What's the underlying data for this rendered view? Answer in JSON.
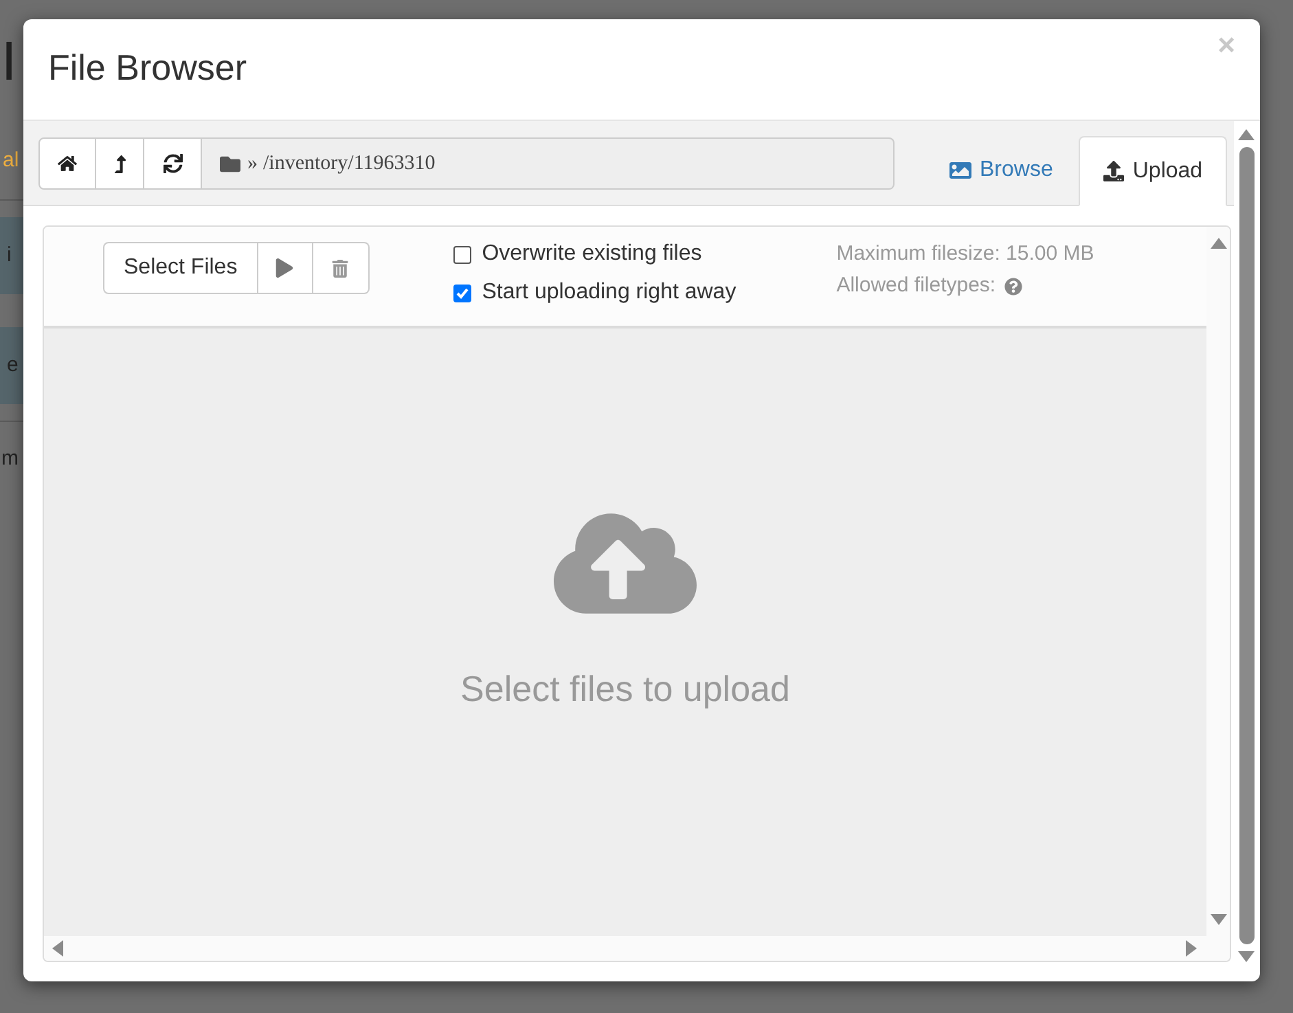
{
  "background": {
    "fragments": [
      {
        "text": "I",
        "kind": "heading"
      },
      {
        "text": "al",
        "kind": "link"
      },
      {
        "text": "i",
        "kind": "bar"
      },
      {
        "text": "e",
        "kind": "bar"
      },
      {
        "text": "m",
        "kind": "plain"
      }
    ]
  },
  "modal": {
    "title": "File Browser",
    "close": "×"
  },
  "toolbar": {
    "separator": "»",
    "path": "/inventory/11963310"
  },
  "tabs": [
    {
      "label": "Browse",
      "selected": false,
      "kind": "browse"
    },
    {
      "label": "Upload",
      "selected": true,
      "kind": "upload"
    }
  ],
  "upload": {
    "select_button": "Select Files",
    "options": [
      {
        "label": "Overwrite existing files",
        "checked": false
      },
      {
        "label": "Start uploading right away",
        "checked": true
      }
    ],
    "max_filesize": "Maximum filesize: 15.00 MB",
    "allowed_filetypes": "Allowed filetypes:",
    "dropzone_text": "Select files to upload"
  }
}
